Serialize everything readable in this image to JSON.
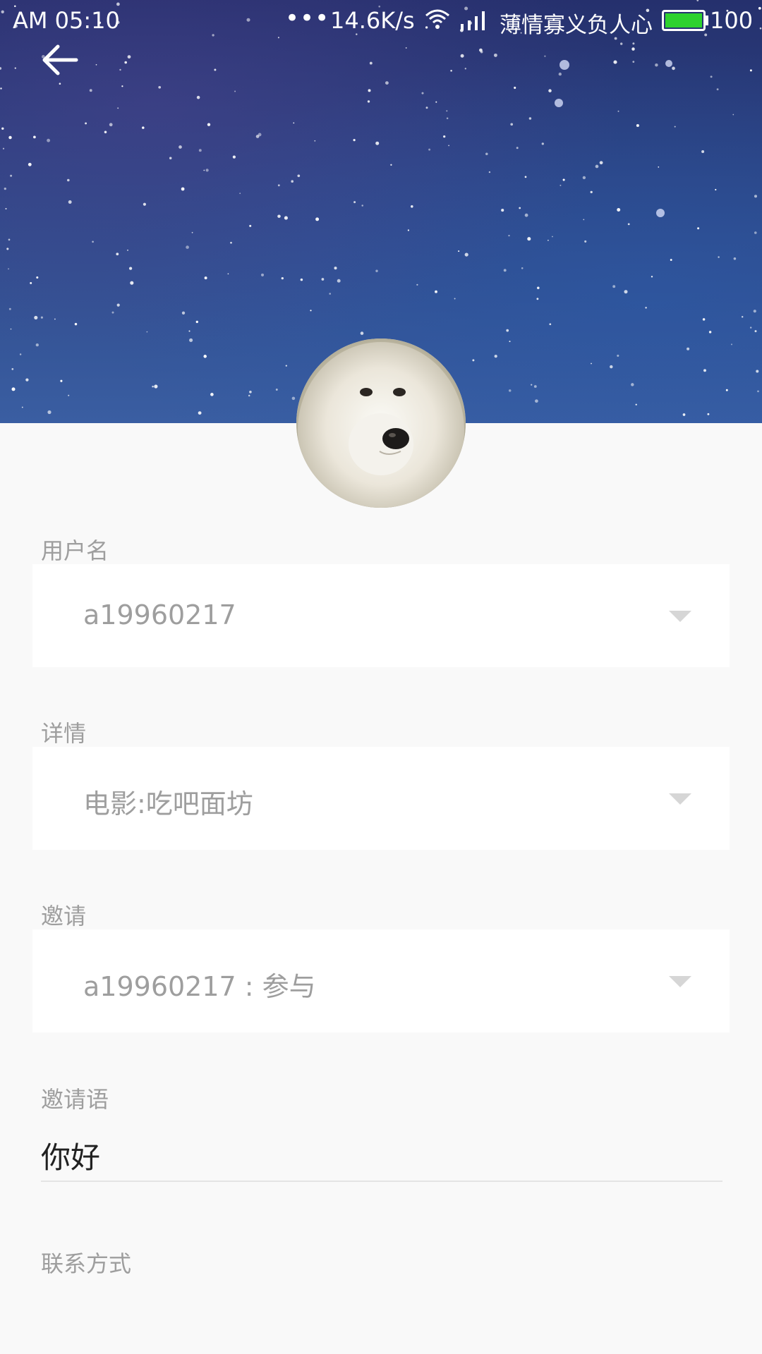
{
  "status_bar": {
    "time": "AM  05:10",
    "dots": "•••",
    "network_speed": "14.6K/s",
    "carrier": "薄情寡义负人心",
    "battery": "100",
    "battery_color": "#2ed22e"
  },
  "icons": {
    "back": "arrow-left-icon",
    "wifi": "wifi-icon",
    "signal": "signal-icon",
    "battery": "battery-icon",
    "dropdown": "chevron-down-icon"
  },
  "form": {
    "username": {
      "label": "用户名",
      "value": "a19960217"
    },
    "details": {
      "label": "详情",
      "value": "电影:吃吧面坊"
    },
    "invite": {
      "label": "邀请",
      "value": "a19960217 : 参与"
    },
    "invite_message": {
      "label": "邀请语",
      "value": "你好"
    },
    "contact": {
      "label": "联系方式"
    }
  },
  "colors": {
    "background": "#f9f9f9",
    "header_sky": "#2d4686",
    "label": "#9e9e9e",
    "input_text": "#212121"
  }
}
